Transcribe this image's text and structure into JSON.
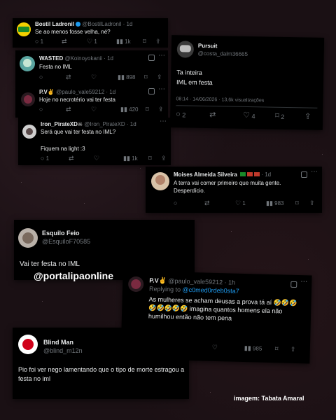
{
  "cards": {
    "c1": {
      "name": "Bostil Ladronil",
      "handle": "@BostilLadronil · 1d",
      "text": "Se ao menos fosse velha, né?",
      "replies": "1",
      "reposts": "",
      "likes": "1",
      "views": "1k"
    },
    "c2": {
      "name": "WASTED",
      "handle": "@Koinoyokanii · 1d",
      "text": "Festa no IML",
      "replies": "",
      "reposts": "",
      "likes": "",
      "views": "898"
    },
    "c3": {
      "name": "P.V",
      "handle": "@paulo_vale59212 · 1d",
      "text": "Hoje no necrotério vai ter festa",
      "replies": "",
      "reposts": "",
      "likes": "",
      "views": "420"
    },
    "c4": {
      "name": "Iron_PirateXD",
      "handle": "@Iron_PirateXD · 1d",
      "text1": "Será que vai ter festa no IML?",
      "text2": "Fiquem na light :3",
      "replies": "1",
      "reposts": "",
      "likes": "",
      "views": "1k"
    },
    "c5": {
      "name": "Pursuit",
      "handle": "@costa_dalm36665",
      "text1": "Ta inteira",
      "text2": "IML  em festa",
      "meta": "08:14 · 14/06/2026 · 13,6k visualizações",
      "replies": "2",
      "reposts": "",
      "likes": "4",
      "bookmarks": "2"
    },
    "c6": {
      "name": "Moises Almeida Silveira",
      "handle": "· 1d",
      "text": "A terra vai comer primeiro que muita gente. Desperdício.",
      "replies": "",
      "reposts": "",
      "likes": "1",
      "views": "983"
    },
    "c7": {
      "name": "Esquilo Feio",
      "handle": "@EsquiloF70585",
      "text": "Vai ter festa no IML"
    },
    "c8": {
      "name": "P.V",
      "handle": "@paulo_vale59212 · 1h",
      "reply_prefix": "Replying to ",
      "reply_to": "@c0med0rdeb0sta7",
      "text": "As mulheres se acham deusas a prova tá aí 🤣🤣🤣🤣🤣🤣🤣🤣 imagina quantos homens ela não humilhou então não tem pena",
      "replies": "7",
      "reposts": "",
      "likes": "",
      "views": "985"
    },
    "c9": {
      "name": "Blind Man",
      "handle": "@blind_m12n",
      "text": "Pio foi ver nego lamentando que o tipo de morte estragou a festa no iml"
    }
  },
  "watermark": "@portalipaonline",
  "credit": "imagem: Tabata Amaral",
  "colors": {
    "background": "#1a1014",
    "card": "#000000",
    "text": "#e7e9ea",
    "muted": "#71767b",
    "link": "#1d9bf0"
  },
  "icons": [
    "reply-icon",
    "repost-icon",
    "like-icon",
    "views-icon",
    "bookmark-icon",
    "share-icon",
    "more-icon",
    "grok-icon",
    "verified-icon"
  ]
}
